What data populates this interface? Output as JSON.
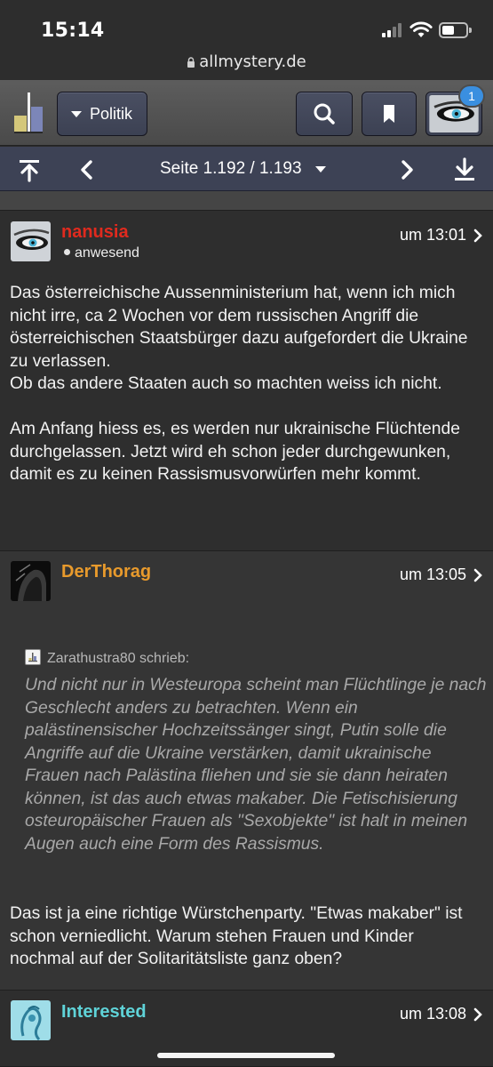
{
  "status_bar": {
    "time": "15:14"
  },
  "browser": {
    "url": "allmystery.de"
  },
  "header": {
    "category_label": "Politik",
    "notification_count": "1"
  },
  "pager": {
    "label": "Seite 1.192 / 1.193"
  },
  "posts": [
    {
      "username": "nanusia",
      "username_color": "#e02a1e",
      "presence": "anwesend",
      "time": "um 13:01",
      "body": "Das österreichische Aussenministerium hat, wenn ich mich nicht irre, ca 2 Wochen vor dem russischen Angriff die österreichischen Staatsbürger dazu aufgefordert die Ukraine zu verlassen.\nOb das andere Staaten auch so machten weiss ich nicht.\n\nAm Anfang hiess es, es werden nur ukrainische Flüchtende durchgelassen. Jetzt wird eh schon jeder durchgewunken, damit es zu keinen Rassismusvorwürfen mehr kommt."
    },
    {
      "username": "DerThorag",
      "username_color": "#e89a2c",
      "time": "um 13:05",
      "quote_author": "Zarathustra80 schrieb:",
      "quote": "Und nicht nur in Westeuropa scheint man Flüchtlinge je nach Geschlecht anders zu betrachten. Wenn ein palästinensischer Hochzeitssänger singt, Putin solle die Angriffe auf die Ukraine verstärken, damit ukrainische Frauen nach Palästina fliehen und sie sie dann heiraten können, ist das auch etwas makaber. Die Fetischisierung osteuropäischer Frauen als \"Sexobjekte\" ist halt in meinen Augen auch eine Form des Rassismus.",
      "body": "Das ist ja eine richtige Würstchenparty. \"Etwas makaber\" ist schon verniedlicht. Warum stehen Frauen und Kinder nochmal auf der Solitaritätsliste ganz oben?"
    },
    {
      "username": "Interested",
      "username_color": "#5fd3d8",
      "time": "um 13:08"
    }
  ]
}
